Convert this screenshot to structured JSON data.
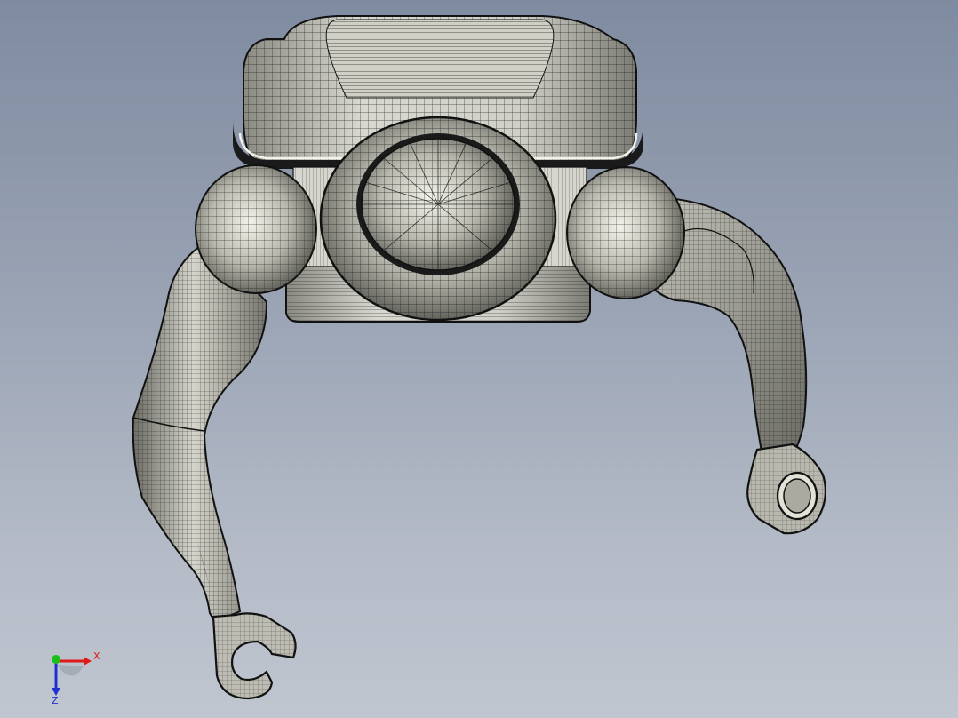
{
  "viewport": {
    "background_top": "#7f8ba0",
    "background_bottom": "#c0c6d0"
  },
  "model": {
    "render_style": "shaded-with-edges",
    "body_color": "#b9b9ad",
    "edge_color": "#111111"
  },
  "triad": {
    "x_label": "X",
    "z_label": "Z",
    "x_color": "#e01818",
    "y_color": "#18c018",
    "z_color": "#2030d0"
  }
}
